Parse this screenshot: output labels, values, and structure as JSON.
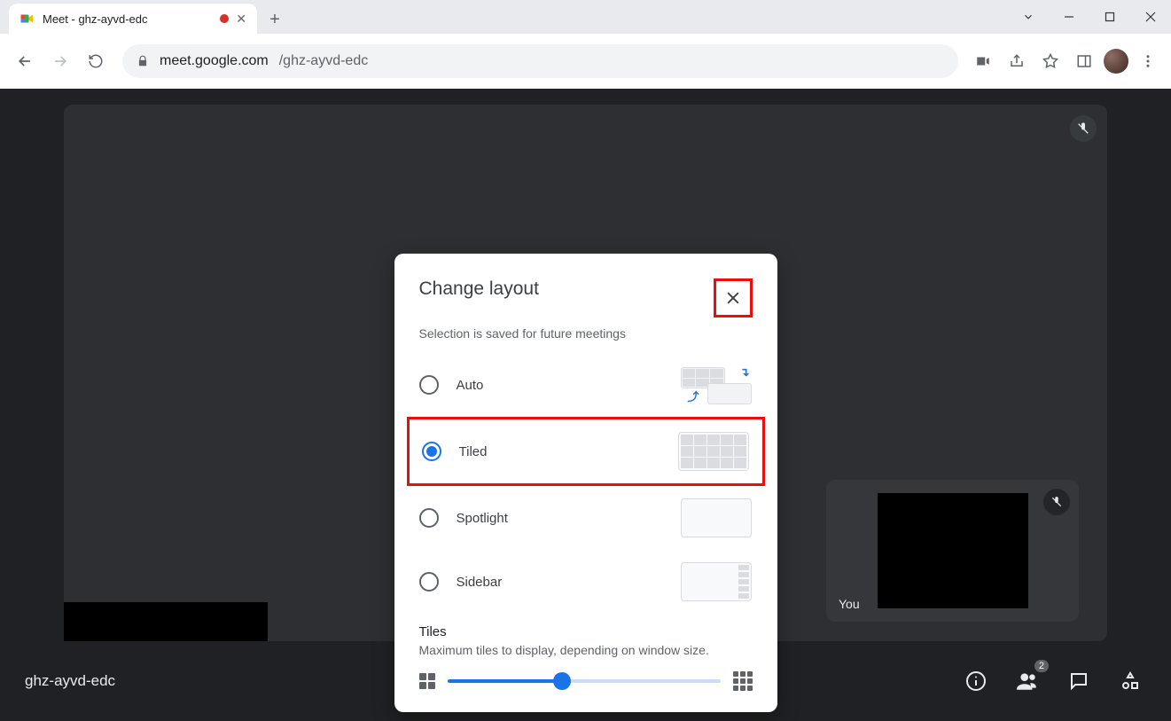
{
  "browser": {
    "tab_title": "Meet - ghz-ayvd-edc",
    "url_host": "meet.google.com",
    "url_path": "/ghz-ayvd-edc"
  },
  "meet": {
    "meeting_code": "ghz-ayvd-edc",
    "self_label": "You",
    "participant_badge": "2"
  },
  "dialog": {
    "title": "Change layout",
    "subtitle": "Selection is saved for future meetings",
    "options": {
      "auto": "Auto",
      "tiled": "Tiled",
      "spotlight": "Spotlight",
      "sidebar": "Sidebar"
    },
    "selected": "tiled",
    "tiles_heading": "Tiles",
    "tiles_desc": "Maximum tiles to display, depending on window size.",
    "slider_value_pct": 42
  }
}
